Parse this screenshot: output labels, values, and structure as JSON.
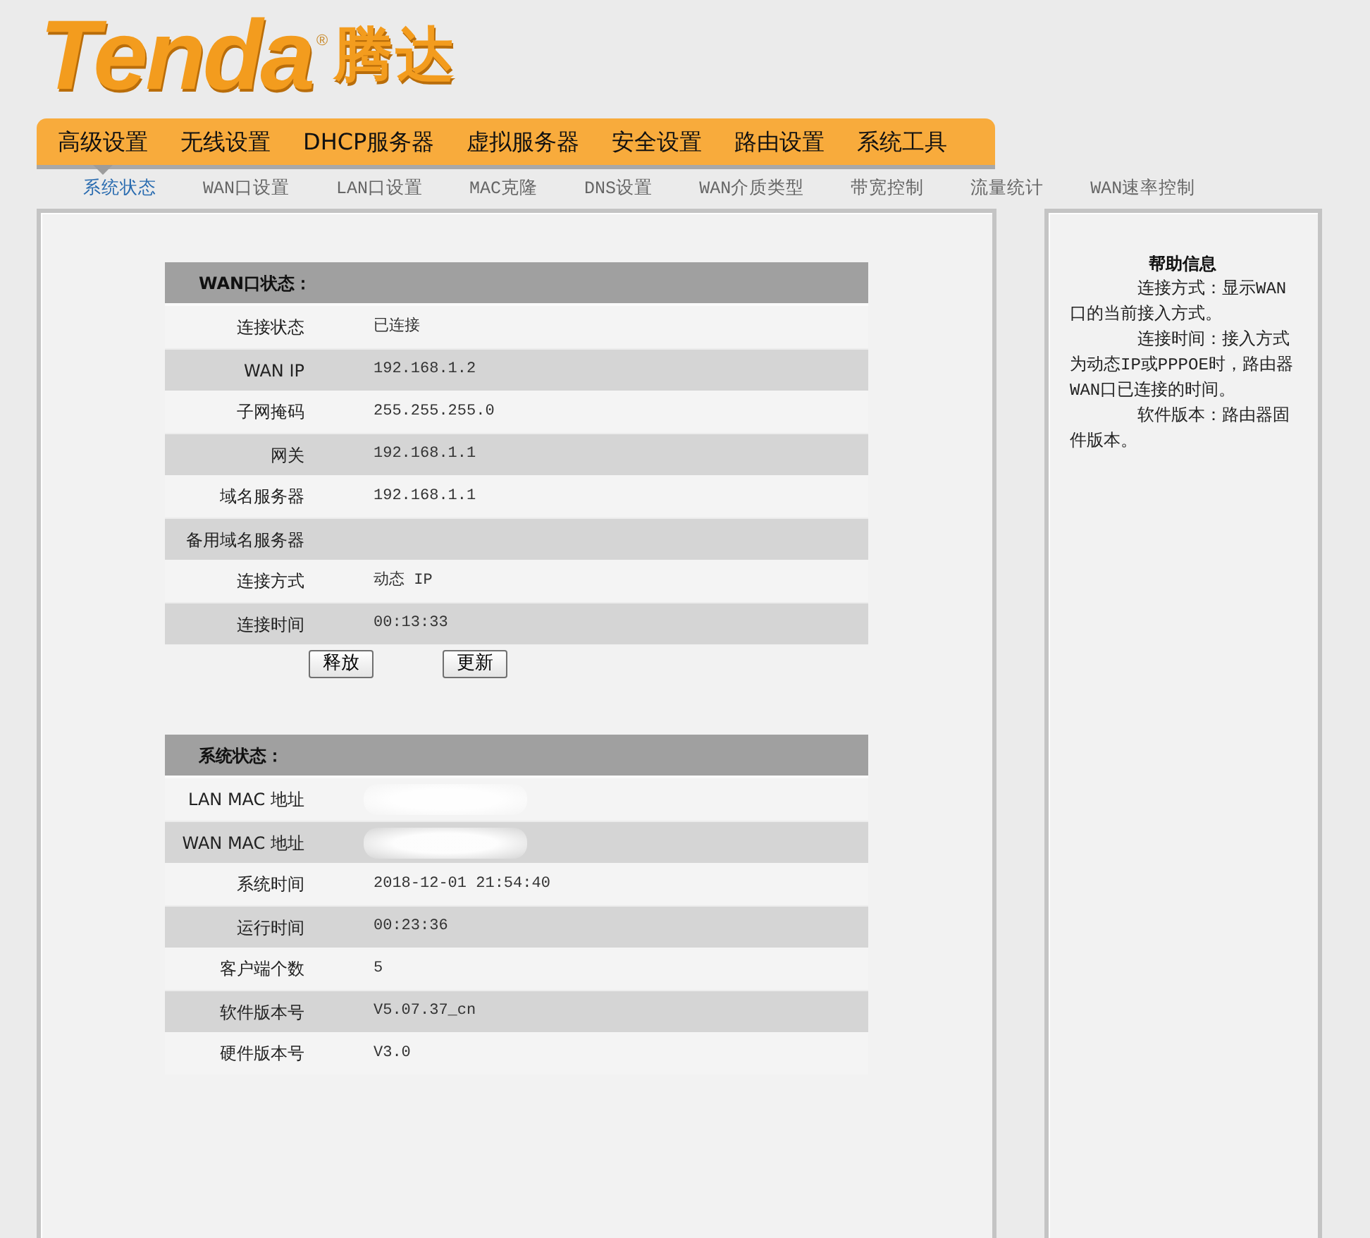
{
  "logo": {
    "brand": "Tenda",
    "mark": "®",
    "name": "腾达"
  },
  "main_tabs": [
    {
      "label": "高级设置",
      "selected": true
    },
    {
      "label": "无线设置",
      "selected": false
    },
    {
      "label": "DHCP服务器",
      "selected": false
    },
    {
      "label": "虚拟服务器",
      "selected": false
    },
    {
      "label": "安全设置",
      "selected": false
    },
    {
      "label": "路由设置",
      "selected": false
    },
    {
      "label": "系统工具",
      "selected": false
    }
  ],
  "sub_tabs": [
    {
      "label": "系统状态",
      "selected": true
    },
    {
      "label": "WAN口设置",
      "selected": false
    },
    {
      "label": "LAN口设置",
      "selected": false
    },
    {
      "label": "MAC克隆",
      "selected": false
    },
    {
      "label": "DNS设置",
      "selected": false
    },
    {
      "label": "WAN介质类型",
      "selected": false
    },
    {
      "label": "带宽控制",
      "selected": false
    },
    {
      "label": "流量统计",
      "selected": false
    },
    {
      "label": "WAN速率控制",
      "selected": false
    }
  ],
  "wan_status": {
    "title": "WAN口状态：",
    "rows": [
      {
        "label": "连接状态",
        "value": "已连接"
      },
      {
        "label": "WAN IP",
        "value": "192.168.1.2"
      },
      {
        "label": "子网掩码",
        "value": "255.255.255.0"
      },
      {
        "label": "网关",
        "value": "192.168.1.1"
      },
      {
        "label": "域名服务器",
        "value": "192.168.1.1"
      },
      {
        "label": "备用域名服务器"
      },
      {
        "label": "连接方式",
        "value": "动态 IP"
      },
      {
        "label": "连接时间",
        "value": "00:13:33"
      }
    ],
    "buttons": [
      "释放",
      "更新"
    ]
  },
  "system_status": {
    "title": "系统状态：",
    "rows": [
      {
        "label": "LAN MAC 地址",
        "kind": "blurred"
      },
      {
        "label": "WAN MAC 地址",
        "kind": "blurred"
      },
      {
        "label": "系统时间",
        "kind": "text",
        "value": "2018-12-01 21:54:40"
      },
      {
        "label": "运行时间",
        "kind": "text",
        "value": "00:23:36"
      },
      {
        "label": "客户端个数",
        "kind": "text",
        "value": "5"
      },
      {
        "label": "软件版本号",
        "kind": "text",
        "value": "V5.07.37_cn"
      },
      {
        "label": "硬件版本号",
        "kind": "text",
        "value": "V3.0"
      }
    ]
  },
  "help": {
    "title": "帮助信息",
    "paragraphs": [
      "连接方式：显示WAN口的当前接入方式。",
      "连接时间：接入方式为动态IP或PPPOE时，路由器WAN口已连接的时间。",
      "软件版本：路由器固件版本。"
    ]
  }
}
